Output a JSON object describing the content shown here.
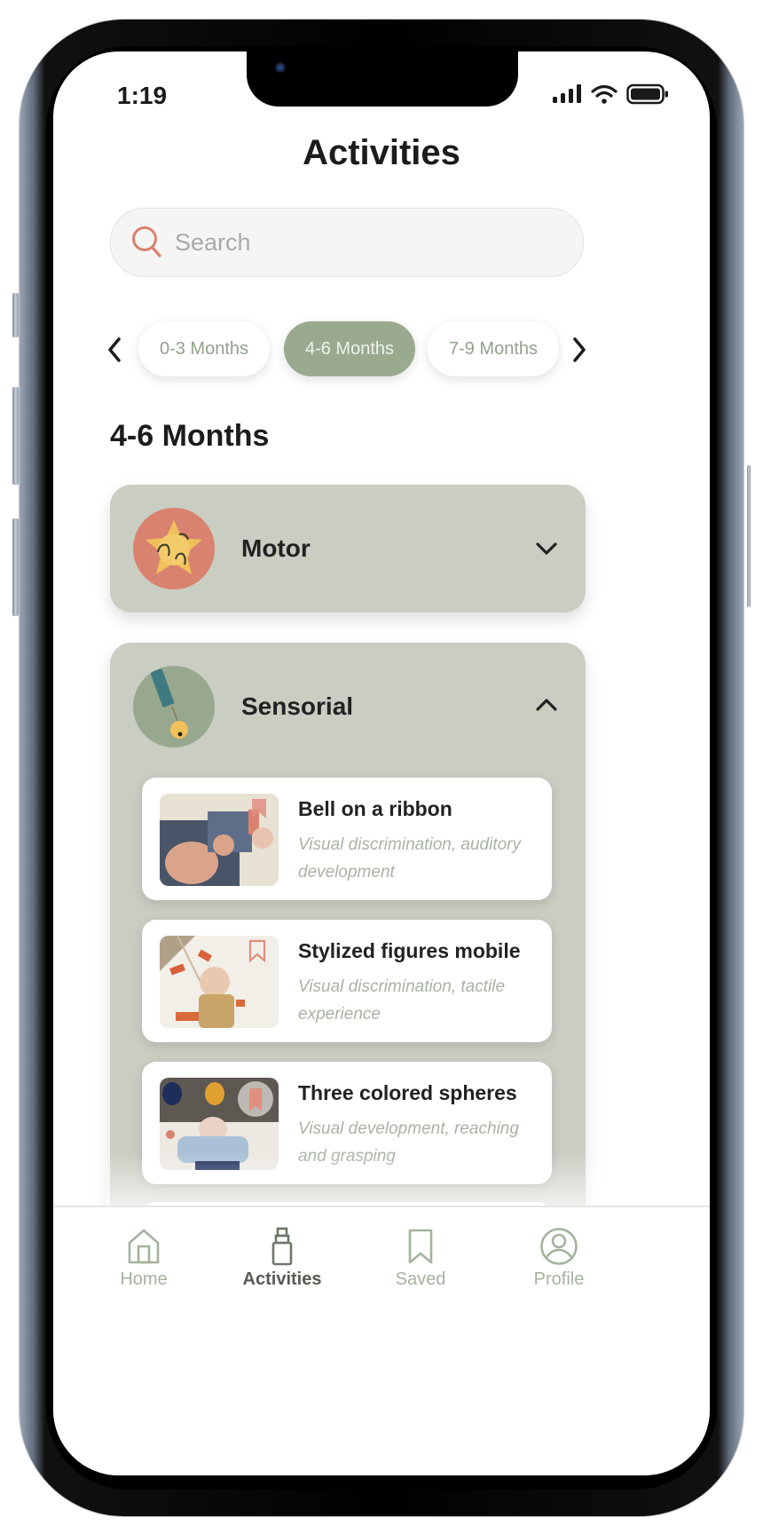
{
  "status_bar": {
    "time": "1:19"
  },
  "header": {
    "title": "Activities"
  },
  "search": {
    "placeholder": "Search",
    "value": ""
  },
  "age_filter": {
    "options": [
      {
        "label": "0-3 Months",
        "active": false
      },
      {
        "label": "4-6 Months",
        "active": true
      },
      {
        "label": "7-9 Months",
        "active": false
      }
    ]
  },
  "section": {
    "title": "4-6 Months"
  },
  "categories": [
    {
      "name": "Motor",
      "expanded": false,
      "icon": "star-toy-icon"
    },
    {
      "name": "Sensorial",
      "expanded": true,
      "icon": "bell-ribbon-icon",
      "activities": [
        {
          "title": "Bell on a ribbon",
          "description": "Visual discrimination, auditory development"
        },
        {
          "title": "Stylized figures mobile",
          "description": "Visual discrimination, tactile experience"
        },
        {
          "title": "Three colored spheres",
          "description": "Visual development, reaching and grasping"
        }
      ]
    }
  ],
  "tab_bar": {
    "tabs": [
      {
        "label": "Home",
        "icon": "home-icon",
        "active": false
      },
      {
        "label": "Activities",
        "icon": "bottle-icon",
        "active": true
      },
      {
        "label": "Saved",
        "icon": "bookmark-icon",
        "active": false
      },
      {
        "label": "Profile",
        "icon": "profile-icon",
        "active": false
      }
    ]
  },
  "colors": {
    "accent_sage": "#9aaa8f",
    "card_bg": "#c9cdc2",
    "search_icon": "#d9826f",
    "motor_icon_bg": "#d9826f",
    "sensorial_icon_bg": "#98a88f",
    "bookmark": "#e08f80"
  }
}
